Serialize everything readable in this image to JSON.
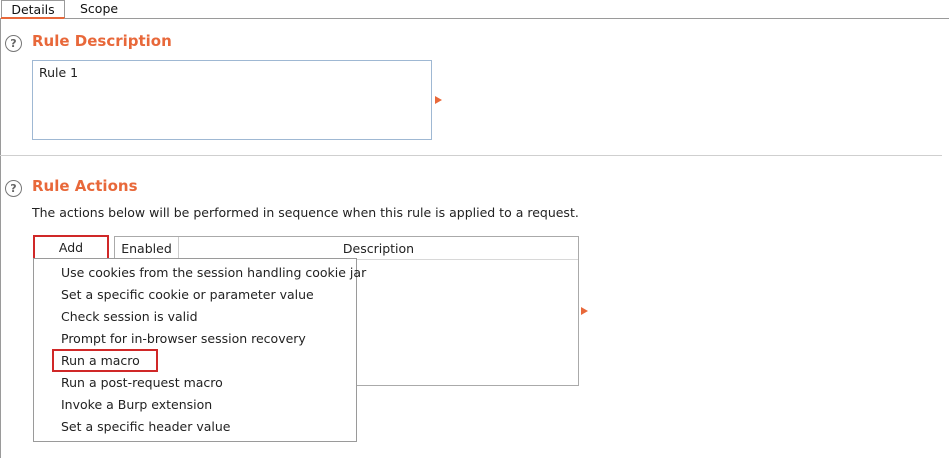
{
  "tabs": [
    {
      "label": "Details",
      "active": true
    },
    {
      "label": "Scope",
      "active": false
    }
  ],
  "accent_color": "#e8683a",
  "highlight_color": "#d02828",
  "rule_description": {
    "title": "Rule Description",
    "help_icon": "?",
    "value": "Rule 1"
  },
  "rule_actions": {
    "title": "Rule Actions",
    "help_icon": "?",
    "description": "The actions below will be performed in sequence when this rule is applied to a request.",
    "add_label": "Add",
    "table": {
      "columns": [
        "Enabled",
        "Description"
      ],
      "rows": []
    },
    "add_menu": [
      "Use cookies from the session handling cookie jar",
      "Set a specific cookie or parameter value",
      "Check session is valid",
      "Prompt for in-browser session recovery",
      "Run a macro",
      "Run a post-request macro",
      "Invoke a Burp extension",
      "Set a specific header value"
    ],
    "highlighted_item": "Run a macro"
  }
}
